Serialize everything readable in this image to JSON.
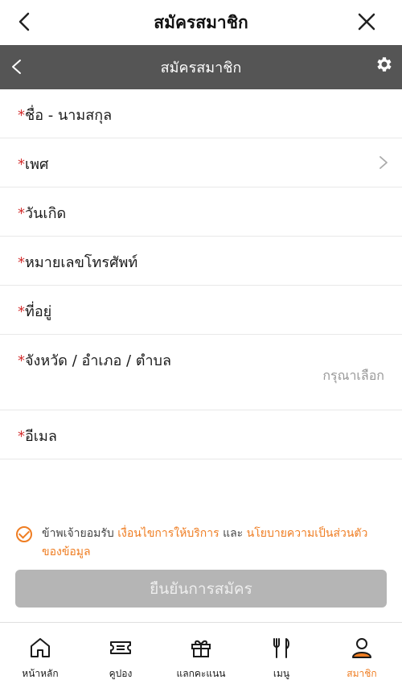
{
  "header": {
    "title": "สมัครสมาชิก"
  },
  "subheader": {
    "title": "สมัครสมาชิก"
  },
  "form": {
    "required_mark": "*",
    "fields": [
      {
        "label": "ชื่อ - นามสกุล"
      },
      {
        "label": "เพศ"
      },
      {
        "label": "วันเกิด"
      },
      {
        "label": "หมายเลขโทรศัพท์"
      },
      {
        "label": "ที่อยู่"
      },
      {
        "label": "จังหวัด / อำเภอ / ตำบล",
        "hint": "กรุณาเลือก"
      },
      {
        "label": "อีเมล"
      }
    ]
  },
  "consent": {
    "prefix": "ข้าพเจ้ายอมรับ ",
    "terms_link": "เงื่อนไขการให้บริการ",
    "and": " และ ",
    "privacy_link": "นโยบายความเป็นส่วนตัวของข้อมูล",
    "checked": true
  },
  "submit_label": "ยืนยันการสมัคร",
  "tabs": [
    {
      "label": "หน้าหลัก",
      "icon": "home-icon"
    },
    {
      "label": "คูปอง",
      "icon": "ticket-icon"
    },
    {
      "label": "แลกคะแนน",
      "icon": "gift-icon"
    },
    {
      "label": "เมนู",
      "icon": "fork-knife-icon"
    },
    {
      "label": "สมาชิก",
      "icon": "user-icon",
      "active": true
    }
  ],
  "colors": {
    "accent": "#ef7d22",
    "subheader_bg": "#555555",
    "required": "#d32f2f",
    "disabled_button": "#b5b5b5"
  }
}
